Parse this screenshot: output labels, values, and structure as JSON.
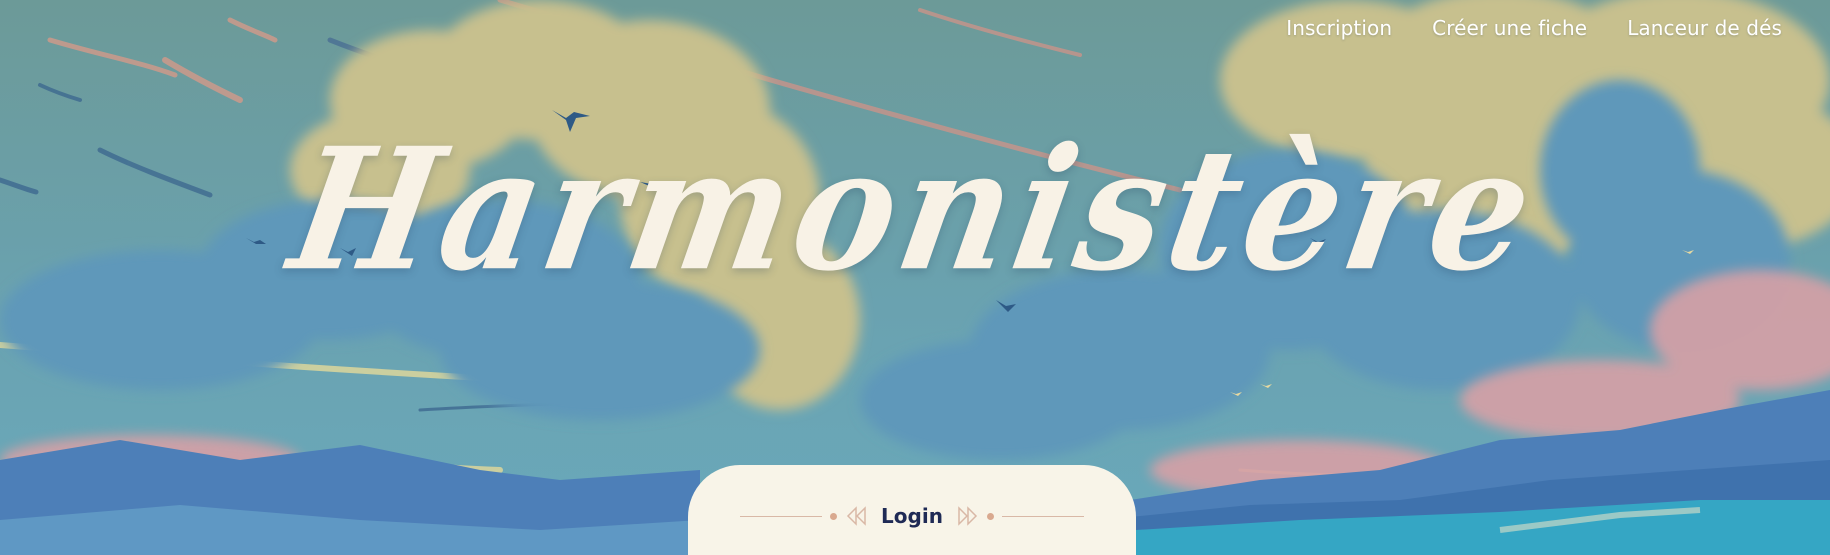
{
  "nav": {
    "items": [
      {
        "label": "Inscription"
      },
      {
        "label": "Créer une fiche"
      },
      {
        "label": "Lanceur de dés"
      }
    ]
  },
  "hero": {
    "title": "Harmonistère"
  },
  "login": {
    "label": "Login"
  },
  "colors": {
    "sky": "#6a9aa0",
    "cloud_yellow": "#c7c08e",
    "cloud_blue": "#5e98ba",
    "mountain_blue": "#4d7fb8",
    "pink_mist": "#d7a0a6",
    "title": "#f8f2e6",
    "panel": "#f8f4e8",
    "login_text": "#1f2a55",
    "ornament": "#d9b8a6"
  },
  "icons": [
    "bird-icon",
    "double-chevron-left-icon",
    "double-chevron-right-icon"
  ]
}
